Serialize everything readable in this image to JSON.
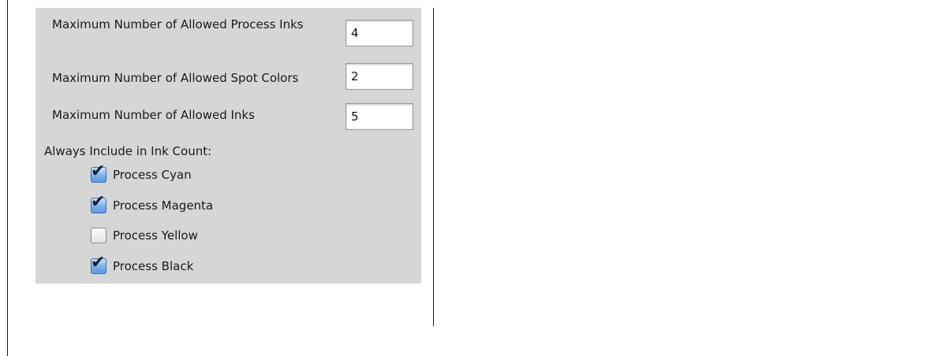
{
  "fields": [
    {
      "label": "Maximum Number of Allowed Process Inks",
      "value": "4"
    },
    {
      "label": "Maximum Number of Allowed Spot Colors",
      "value": "2"
    },
    {
      "label": "Maximum Number of Allowed Inks",
      "value": "5"
    }
  ],
  "ink_count": {
    "label": "Always Include in Ink Count:",
    "options": [
      {
        "label": "Process Cyan",
        "checked": true
      },
      {
        "label": "Process Magenta",
        "checked": true
      },
      {
        "label": "Process Yellow",
        "checked": false
      },
      {
        "label": "Process Black",
        "checked": true
      }
    ]
  },
  "colors": {
    "panel_bg": "#d6d6d6",
    "checkbox_checked": "#7cb0ea"
  }
}
